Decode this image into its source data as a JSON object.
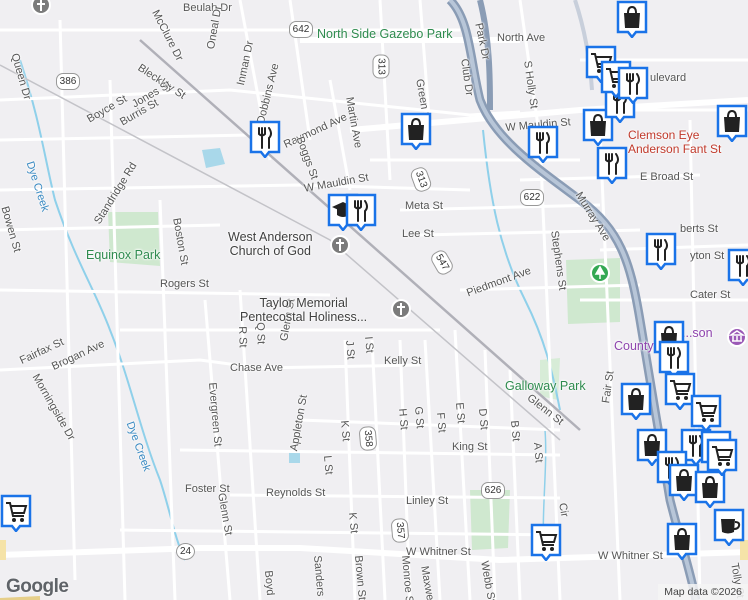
{
  "map": {
    "attribution": "Map data ©2026",
    "logo": "Google"
  },
  "pois": {
    "north_side_gazebo_park": "North Side Gazebo Park",
    "west_anderson_church": "West Anderson\nChurch of God",
    "equinox_park": "Equinox Park",
    "taylor_memorial": "Taylor Memorial\nPentecostal Holiness...",
    "galloway_park": "Galloway Park",
    "clemson_eye": "Clemson Eye\nAnderson Fant St",
    "county_partial": "County",
    "anderson_partial": "...son"
  },
  "streets": {
    "beulah_dr": "Beulah Dr",
    "mcclure_dr": "McClure Dr",
    "oneal_dr": "Oneal Dr",
    "inman_dr": "Inman Dr",
    "dobbins_ave": "Dobbins Ave",
    "raymond_ave": "Raymond Ave",
    "boggs_st": "Boggs St",
    "bleckley_st": "Bleckley St",
    "queen_dr": "Queen Dr",
    "boyce_st": "Boyce St",
    "jones_st": "Jones St",
    "burris_st": "Burris St",
    "standridge_rd": "Standridge Rd",
    "bowen_st": "Bowen St",
    "dye_creek_1": "Dye Creek",
    "dye_creek_2": "Dye Creek",
    "boston_st": "Boston St",
    "rogers_st": "Rogers St",
    "fairfax_st": "Fairfax St",
    "brogan_ave": "Brogan Ave",
    "morningside_dr": "Morningside Dr",
    "evergreen_st": "Evergreen St",
    "chase_ave": "Chase Ave",
    "r_st": "R St",
    "q_st": "Q St",
    "glenn_st": "Glenn St",
    "glenn_st_2": "Glenn St",
    "glenn_st_3": "Glenn St",
    "foster_st": "Foster St",
    "appleton_st": "Appleton St",
    "reynolds_st": "Reynolds St",
    "l_st": "L St",
    "k_st": "K St",
    "k_st_2": "K St",
    "j_st": "J St",
    "i_st": "I St",
    "h_st": "H St",
    "g_st": "G St",
    "f_st": "F St",
    "e_st": "E St",
    "d_st": "D St",
    "b_st": "B St",
    "a_st": "A St",
    "kelly_st": "Kelly St",
    "king_st": "King St",
    "linley_st": "Linley St",
    "brown_st": "Brown St",
    "monroe_st": "Monroe St",
    "maxwell": "Maxwell",
    "webb_st": "Webb St",
    "sanders_st": "Sanders St",
    "boyd": "Boyd",
    "tolly_st": "Tolly St",
    "w_whitner_st": "W Whitner St",
    "w_whitner_st_2": "W Whitner St",
    "w_mauldin_st": "W Mauldin St",
    "w_mauldin_st_2": "W Mauldin St",
    "meta_st": "Meta St",
    "lee_st": "Lee St",
    "martin_ave": "Martin Ave",
    "green_st": "Green St",
    "north_ave": "North Ave",
    "park_dr": "Park Dr",
    "club_dr": "Club Dr",
    "murray_ave": "Murray Ave",
    "piedmont_ave": "Piedmont Ave",
    "stephens_st": "Stephens St",
    "e_broad_st": "E Broad St",
    "cater_st": "Cater St",
    "fair_st": "Fair St",
    "s_holly_st": "S Holly St",
    "boulevard": "ulevard",
    "roberts_partial": "berts St",
    "dayton_partial": "yton St",
    "cir_partial": "Cir",
    "d_st_short": "d"
  },
  "route_shields": [
    "642",
    "386",
    "313",
    "313",
    "622",
    "547",
    "358",
    "357",
    "626",
    "24"
  ],
  "markers": [
    {
      "icon": "restaurant-icon"
    },
    {
      "icon": "shopping-bag-icon"
    },
    {
      "icon": "school-icon"
    },
    {
      "icon": "restaurant-icon"
    },
    {
      "icon": "restaurant-icon"
    },
    {
      "icon": "shopping-bag-icon"
    },
    {
      "icon": "restaurant-icon"
    },
    {
      "icon": "restaurant-icon"
    },
    {
      "icon": "shopping-cart-icon"
    },
    {
      "icon": "shopping-cart-icon"
    },
    {
      "icon": "restaurant-icon"
    },
    {
      "icon": "shopping-bag-icon"
    },
    {
      "icon": "shopping-bag-icon"
    },
    {
      "icon": "restaurant-icon"
    },
    {
      "icon": "restaurant-icon"
    },
    {
      "icon": "coffee-icon"
    },
    {
      "icon": "shopping-bag-icon"
    },
    {
      "icon": "restaurant-icon"
    },
    {
      "icon": "shopping-cart-icon"
    },
    {
      "icon": "shopping-bag-icon"
    },
    {
      "icon": "shopping-cart-icon"
    },
    {
      "icon": "shopping-bag-icon"
    },
    {
      "icon": "restaurant-icon"
    },
    {
      "icon": "restaurant-icon"
    },
    {
      "icon": "shopping-bag-icon"
    },
    {
      "icon": "shopping-bag-icon"
    },
    {
      "icon": "coffee-icon"
    },
    {
      "icon": "shopping-cart-icon"
    },
    {
      "icon": "shopping-bag-icon"
    },
    {
      "icon": "shopping-cart-icon"
    },
    {
      "icon": "shopping-cart-icon"
    }
  ],
  "colors": {
    "marker_fill": "#1a73e8",
    "park_green": "#c8e6c9",
    "highway": "#8a9cb5",
    "water": "#7ec8e3"
  }
}
